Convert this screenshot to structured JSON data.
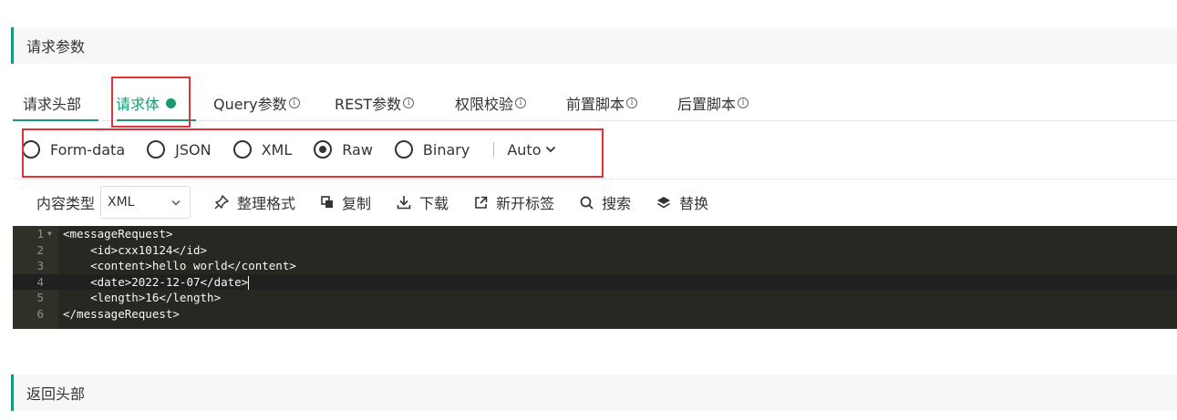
{
  "request_section": {
    "title": "请求参数"
  },
  "tabs": [
    {
      "label": "请求头部",
      "info": false
    },
    {
      "label": "请求体",
      "info": false,
      "active": true,
      "dot": true
    },
    {
      "label": "Query参数",
      "info": true
    },
    {
      "label": "REST参数",
      "info": true
    },
    {
      "label": "权限校验",
      "info": true
    },
    {
      "label": "前置脚本",
      "info": true
    },
    {
      "label": "后置脚本",
      "info": true
    }
  ],
  "info_glyph": "i",
  "body_types": [
    {
      "label": "Form-data",
      "selected": false
    },
    {
      "label": "JSON",
      "selected": false
    },
    {
      "label": "XML",
      "selected": false
    },
    {
      "label": "Raw",
      "selected": true
    },
    {
      "label": "Binary",
      "selected": false
    }
  ],
  "auto_select": {
    "label": "Auto"
  },
  "toolbar": {
    "content_type_label": "内容类型",
    "content_type_value": "XML",
    "format_label": "整理格式",
    "copy_label": "复制",
    "download_label": "下载",
    "open_tab_label": "新开标签",
    "search_label": "搜索",
    "replace_label": "替换"
  },
  "editor": {
    "lines": [
      {
        "no": "1",
        "text": "<messageRequest>"
      },
      {
        "no": "2",
        "text": "    <id>cxx10124</id>"
      },
      {
        "no": "3",
        "text": "    <content>hello world</content>"
      },
      {
        "no": "4",
        "text": "    <date>2022-12-07</date>"
      },
      {
        "no": "5",
        "text": "    <length>16</length>"
      },
      {
        "no": "6",
        "text": "</messageRequest>"
      }
    ],
    "active_line": 4
  },
  "response_section": {
    "title": "返回头部"
  },
  "colors": {
    "accent": "#1a9a74",
    "highlight_box": "#e0323a",
    "editor_bg": "#272822"
  }
}
